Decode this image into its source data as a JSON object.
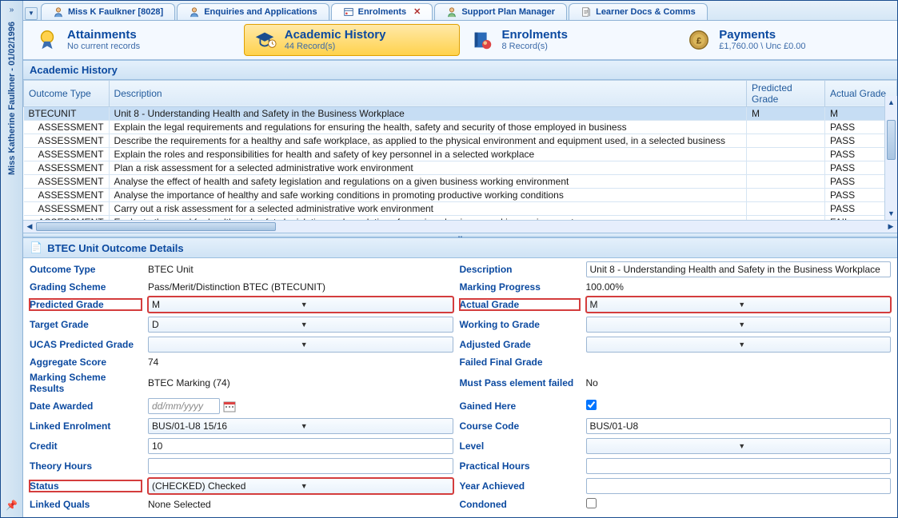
{
  "sidebar": {
    "title": "Miss Katherine Faulkner - 01/02/1996"
  },
  "tabs": [
    {
      "label": "Miss K Faulkner [8028]",
      "icon": "person"
    },
    {
      "label": "Enquiries and Applications",
      "icon": "person"
    },
    {
      "label": "Enrolments",
      "icon": "enrolment",
      "active": true,
      "closable": true
    },
    {
      "label": "Support Plan Manager",
      "icon": "person"
    },
    {
      "label": "Learner Docs & Comms",
      "icon": "doc"
    }
  ],
  "cards": {
    "attainments": {
      "title": "Attainments",
      "sub": "No current records"
    },
    "academic": {
      "title": "Academic History",
      "sub": "44 Record(s)"
    },
    "enrolments": {
      "title": "Enrolments",
      "sub": "8 Record(s)"
    },
    "payments": {
      "title": "Payments",
      "sub": "£1,760.00 \\ Unc £0.00"
    }
  },
  "grid": {
    "title": "Academic History",
    "columns": {
      "outcome": "Outcome Type",
      "desc": "Description",
      "pred": "Predicted Grade",
      "actual": "Actual Grade"
    },
    "rows": [
      {
        "outcome": "BTECUNIT",
        "desc": "Unit 8 - Understanding Health and Safety in the Business Workplace",
        "pred": "M",
        "actual": "M",
        "sel": true
      },
      {
        "outcome": "ASSESSMENT",
        "desc": "Explain the legal requirements and regulations for ensuring the health, safety and security of those employed in business",
        "pred": "",
        "actual": "PASS"
      },
      {
        "outcome": "ASSESSMENT",
        "desc": "Describe the requirements for a healthy and safe workplace, as applied to the physical environment and equipment used, in a selected business",
        "pred": "",
        "actual": "PASS"
      },
      {
        "outcome": "ASSESSMENT",
        "desc": "Explain the roles and responsibilities for health and safety of key personnel in a selected workplace",
        "pred": "",
        "actual": "PASS"
      },
      {
        "outcome": "ASSESSMENT",
        "desc": "Plan a risk assessment for a selected administrative work environment",
        "pred": "",
        "actual": "PASS"
      },
      {
        "outcome": "ASSESSMENT",
        "desc": "Analyse the effect of health and safety legislation and regulations on a given business working environment",
        "pred": "",
        "actual": "PASS"
      },
      {
        "outcome": "ASSESSMENT",
        "desc": "Analyse the importance of healthy and safe working conditions in promoting productive working conditions",
        "pred": "",
        "actual": "PASS"
      },
      {
        "outcome": "ASSESSMENT",
        "desc": "Carry out a risk assessment for a selected administrative work environment",
        "pred": "",
        "actual": "PASS"
      },
      {
        "outcome": "ASSESSMENT",
        "desc": "Evaluate the need for health and safety legislation and regulations for a given business working environment",
        "pred": "",
        "actual": "FAIL"
      }
    ]
  },
  "details": {
    "title": "BTEC Unit Outcome Details",
    "labels": {
      "outcomeType": "Outcome Type",
      "gradingScheme": "Grading Scheme",
      "predictedGrade": "Predicted Grade",
      "targetGrade": "Target Grade",
      "ucasPredicted": "UCAS Predicted Grade",
      "aggregateScore": "Aggregate Score",
      "markingSchemeResults": "Marking Scheme Results",
      "dateAwarded": "Date Awarded",
      "linkedEnrolment": "Linked Enrolment",
      "credit": "Credit",
      "theoryHours": "Theory Hours",
      "status": "Status",
      "linkedQuals": "Linked Quals",
      "description": "Description",
      "markingProgress": "Marking Progress",
      "actualGrade": "Actual Grade",
      "workingToGrade": "Working to Grade",
      "adjustedGrade": "Adjusted Grade",
      "failedFinal": "Failed Final Grade",
      "mustPass": "Must Pass element failed",
      "gainedHere": "Gained Here",
      "courseCode": "Course Code",
      "level": "Level",
      "practicalHours": "Practical Hours",
      "yearAchieved": "Year Achieved",
      "condoned": "Condoned"
    },
    "values": {
      "outcomeType": "BTEC Unit",
      "gradingScheme": "Pass/Merit/Distinction BTEC (BTECUNIT)",
      "predictedGrade": "M",
      "targetGrade": "D",
      "ucasPredicted": "",
      "aggregateScore": "74",
      "markingSchemeResults": "BTEC Marking (74)",
      "dateAwardedPlaceholder": "dd/mm/yyyy",
      "linkedEnrolment": "BUS/01-U8 15/16",
      "credit": "10",
      "theoryHours": "",
      "status": "(CHECKED) Checked",
      "linkedQuals": "None Selected",
      "description": "Unit 8 - Understanding Health and Safety in the Business Workplace",
      "markingProgress": "100.00%",
      "actualGrade": "M",
      "workingToGrade": "",
      "adjustedGrade": "",
      "failedFinal": "",
      "mustPass": "No",
      "gainedHere": true,
      "courseCode": "BUS/01-U8",
      "level": "",
      "practicalHours": "",
      "yearAchieved": "",
      "condoned": false
    }
  }
}
